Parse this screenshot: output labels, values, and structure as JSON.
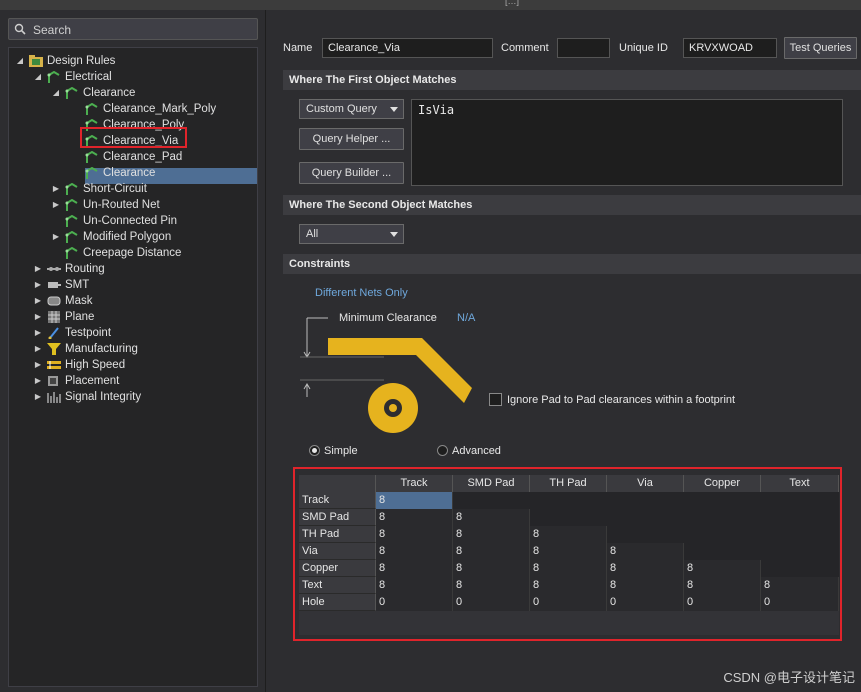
{
  "window": {
    "title_fragment": "[…]"
  },
  "search": {
    "label": "Search"
  },
  "tree": {
    "root": "Design Rules",
    "electrical": "Electrical",
    "clearance_group": "Clearance",
    "clearance_items": [
      "Clearance_Mark_Poly",
      "Clearance_Poly",
      "Clearance_Via",
      "Clearance_Pad",
      "Clearance"
    ],
    "electrical_items": [
      "Short-Circuit",
      "Un-Routed Net",
      "Un-Connected Pin",
      "Modified Polygon",
      "Creepage Distance"
    ],
    "categories": [
      "Routing",
      "SMT",
      "Mask",
      "Plane",
      "Testpoint",
      "Manufacturing",
      "High Speed",
      "Placement",
      "Signal Integrity"
    ]
  },
  "rule": {
    "name_label": "Name",
    "name_value": "Clearance_Via",
    "comment_label": "Comment",
    "comment_value": "",
    "uid_label": "Unique ID",
    "uid_value": "KRVXWOAD",
    "test_queries": "Test Queries"
  },
  "first_object": {
    "header": "Where The First Object Matches",
    "combo": "Custom Query",
    "helper": "Query Helper ...",
    "builder": "Query Builder ...",
    "query": "IsVia"
  },
  "second_object": {
    "header": "Where The Second Object Matches",
    "combo": "All"
  },
  "constraints": {
    "header": "Constraints",
    "nets_label": "Different Nets Only",
    "min_clearance_label": "Minimum Clearance",
    "min_clearance_value": "N/A",
    "ignore_pad": "Ignore Pad to Pad clearances within a footprint",
    "simple": "Simple",
    "advanced": "Advanced"
  },
  "matrix": {
    "columns": [
      "Track",
      "SMD Pad",
      "TH Pad",
      "Via",
      "Copper",
      "Text"
    ],
    "rows": [
      {
        "label": "Track",
        "values": [
          "8"
        ]
      },
      {
        "label": "SMD Pad",
        "values": [
          "8",
          "8"
        ]
      },
      {
        "label": "TH Pad",
        "values": [
          "8",
          "8",
          "8"
        ]
      },
      {
        "label": "Via",
        "values": [
          "8",
          "8",
          "8",
          "8"
        ]
      },
      {
        "label": "Copper",
        "values": [
          "8",
          "8",
          "8",
          "8",
          "8"
        ]
      },
      {
        "label": "Text",
        "values": [
          "8",
          "8",
          "8",
          "8",
          "8",
          "8"
        ]
      },
      {
        "label": "Hole",
        "values": [
          "0",
          "0",
          "0",
          "0",
          "0",
          "0"
        ]
      }
    ]
  },
  "colors": {
    "accent": "#6fa8dc",
    "highlight": "#e0242b",
    "selection": "#4e6e94",
    "copper": "#e6b31e"
  },
  "watermark": "CSDN @电子设计笔记"
}
